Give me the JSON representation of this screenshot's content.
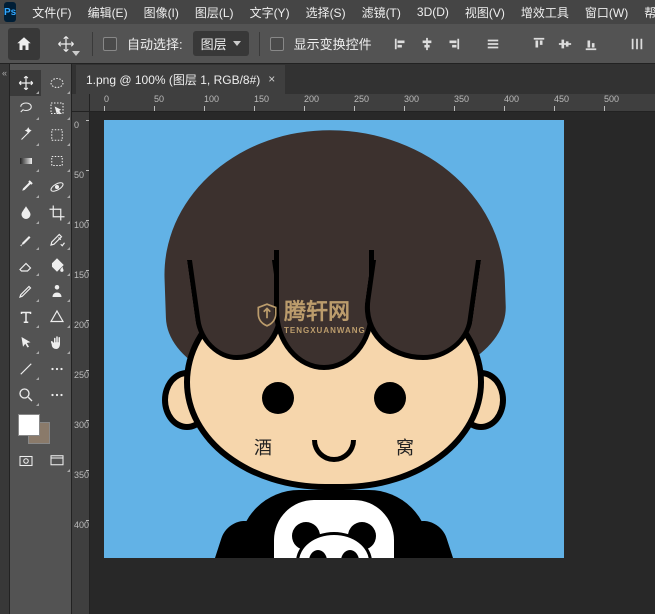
{
  "app": {
    "logo_text": "Ps"
  },
  "menu": {
    "file": "文件(F)",
    "edit": "编辑(E)",
    "image": "图像(I)",
    "layer": "图层(L)",
    "type": "文字(Y)",
    "select": "选择(S)",
    "filter": "滤镜(T)",
    "three_d": "3D(D)",
    "view": "视图(V)",
    "plugins": "增效工具",
    "window": "窗口(W)",
    "help": "帮助(H)"
  },
  "options": {
    "auto_select_label": "自动选择:",
    "auto_select_checked": false,
    "layer_dropdown": "图层",
    "show_transform_label": "显示变换控件",
    "show_transform_checked": false
  },
  "tab": {
    "title": "1.png @ 100% (图层 1, RGB/8#)",
    "close": "×"
  },
  "ruler": {
    "h": [
      "0",
      "50",
      "100",
      "150",
      "200",
      "250",
      "300",
      "350",
      "400",
      "450",
      "500"
    ],
    "v": [
      "0",
      "5",
      "0",
      "1",
      "0",
      "1",
      "5",
      "2",
      "0",
      "2",
      "5",
      "3",
      "0",
      "3",
      "5",
      "4",
      "0"
    ]
  },
  "ruler_v_marks": [
    "0",
    "50",
    "100",
    "150",
    "200",
    "250",
    "300",
    "350",
    "400"
  ],
  "canvas": {
    "cheek_left": "酒",
    "cheek_right": "窝",
    "watermark_main": "腾轩网",
    "watermark_sub": "TENGXUANWANG"
  },
  "colors": {
    "foreground": "#ffffff",
    "background": "#8a7a6a"
  }
}
